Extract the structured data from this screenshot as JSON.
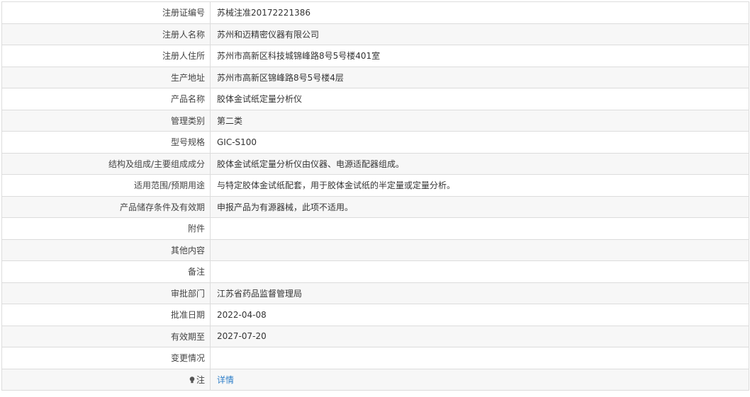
{
  "rows": [
    {
      "label": "注册证编号",
      "value": "苏械注准20172221386"
    },
    {
      "label": "注册人名称",
      "value": "苏州和迈精密仪器有限公司"
    },
    {
      "label": "注册人住所",
      "value": "苏州市高新区科技城锦峰路8号5号楼401室"
    },
    {
      "label": "生产地址",
      "value": "苏州市高新区锦峰路8号5号楼4层"
    },
    {
      "label": "产品名称",
      "value": "胶体金试纸定量分析仪"
    },
    {
      "label": "管理类别",
      "value": "第二类"
    },
    {
      "label": "型号规格",
      "value": "GIC-S100"
    },
    {
      "label": "结构及组成/主要组成成分",
      "value": "胶体金试纸定量分析仪由仪器、电源适配器组成。"
    },
    {
      "label": "适用范围/预期用途",
      "value": "与特定胶体金试纸配套，用于胶体金试纸的半定量或定量分析。"
    },
    {
      "label": "产品储存条件及有效期",
      "value": "申报产品为有源器械，此项不适用。"
    },
    {
      "label": "附件",
      "value": ""
    },
    {
      "label": "其他内容",
      "value": ""
    },
    {
      "label": "备注",
      "value": ""
    },
    {
      "label": "审批部门",
      "value": "江苏省药品监督管理局"
    },
    {
      "label": "批准日期",
      "value": "2022-04-08"
    },
    {
      "label": "有效期至",
      "value": "2027-07-20"
    },
    {
      "label": "变更情况",
      "value": ""
    }
  ],
  "note": {
    "label": "注",
    "link_text": "详情",
    "icon": "lightbulb-icon"
  },
  "colors": {
    "link": "#2f7fc9",
    "border": "#dcdcdc",
    "stripe": "#f7f7f7"
  }
}
